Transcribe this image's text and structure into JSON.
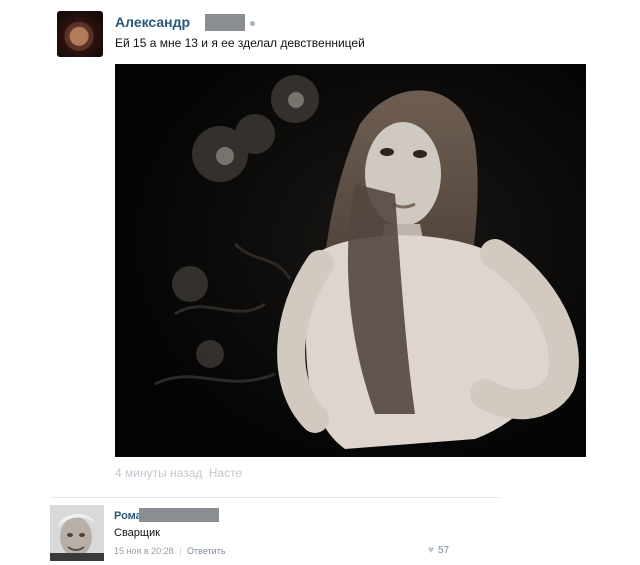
{
  "post": {
    "author": "Александр",
    "text": "Ей 15 а мне 13 и я ее зделал девственницей",
    "time": "4 минуты назад",
    "mention": "Насте"
  },
  "comment": {
    "author": "Рома",
    "text": "Сварщик",
    "date": "15 ноя в 20:28",
    "separator": "|",
    "reply": "Ответить",
    "likes": "57"
  },
  "icons": {
    "like": "heart-icon",
    "online": "online-dot-icon"
  },
  "colors": {
    "link": "#2b587a",
    "meta": "#c2c7cd",
    "redaction": "#8a8d91"
  }
}
